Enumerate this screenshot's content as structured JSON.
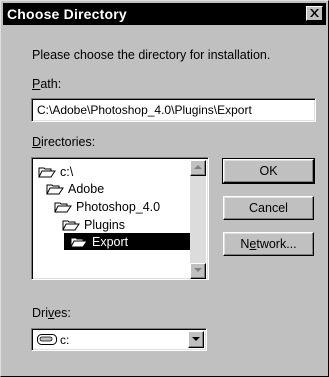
{
  "window": {
    "title": "Choose Directory",
    "close_glyph": "✕"
  },
  "instructions": "Please choose the directory for installation.",
  "path": {
    "label_mnemonic": "P",
    "label_rest": "ath:",
    "value": "C:\\Adobe\\Photoshop_4.0\\Plugins\\Export"
  },
  "directories": {
    "label_mnemonic": "D",
    "label_rest": "irectories:",
    "items": [
      {
        "label": "c:\\",
        "icon": "open-folder-icon",
        "selected": false
      },
      {
        "label": "Adobe",
        "icon": "open-folder-icon",
        "selected": false
      },
      {
        "label": "Photoshop_4.0",
        "icon": "open-folder-icon",
        "selected": false
      },
      {
        "label": "Plugins",
        "icon": "open-folder-icon",
        "selected": false
      },
      {
        "label": "Export",
        "icon": "open-folder-icon",
        "selected": true
      }
    ]
  },
  "buttons": {
    "ok": "OK",
    "cancel": "Cancel",
    "network_pre": "N",
    "network_mnemonic": "e",
    "network_rest": "twork..."
  },
  "drives": {
    "label_pre": "Dri",
    "label_mnemonic": "v",
    "label_rest": "es:",
    "value": "c:",
    "icon": "hard-drive-icon"
  },
  "colors": {
    "face": "#c0c0c0",
    "titlebar": "#000000",
    "selection": "#000000"
  }
}
